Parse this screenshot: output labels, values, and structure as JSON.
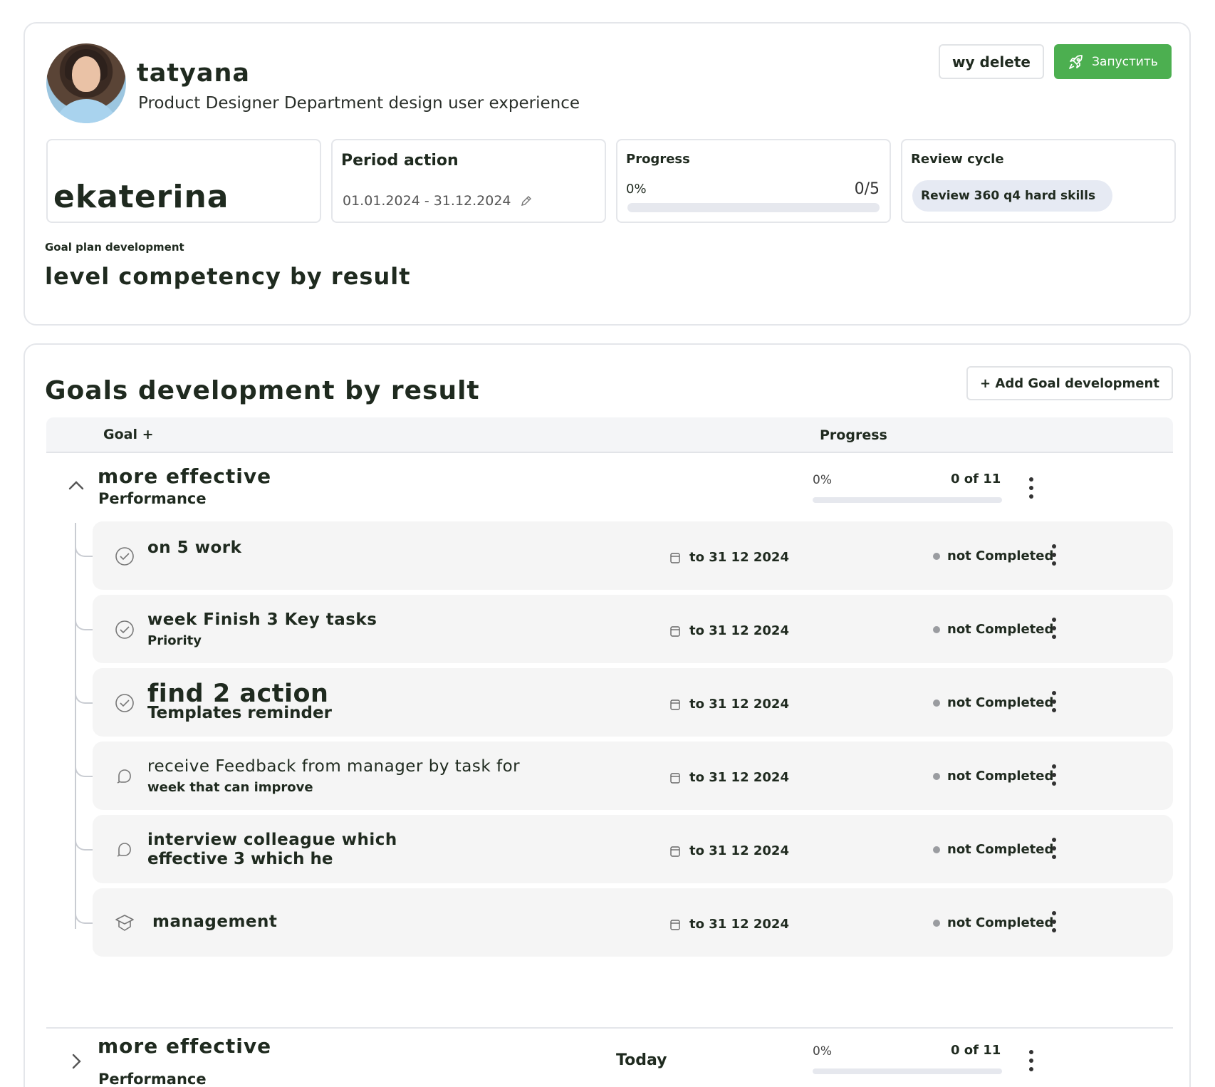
{
  "profile": {
    "name": "tatyana",
    "role": "Product Designer Department design user experience",
    "delete_label": "wy delete",
    "launch_label": "Запустить",
    "owner_name": "ekaterina",
    "period": {
      "title": "Period action",
      "dates": "01.01.2024 - 31.12.2024"
    },
    "progress": {
      "title": "Progress",
      "percent": "0%",
      "count": "0/5",
      "fraction": 0
    },
    "review": {
      "title": "Review cycle",
      "chip": "Review 360 q4 hard skills"
    },
    "plan_label": "Goal plan development",
    "plan_title": "level competency by result"
  },
  "goals": {
    "section_title": "Goals development by result",
    "add_label": "+ Add Goal development",
    "columns": {
      "goal": "Goal +",
      "progress": "Progress"
    },
    "groups": [
      {
        "title": "more effective",
        "subtitle": "Performance",
        "percent": "0%",
        "count": "0 of 11",
        "expanded": true
      },
      {
        "title": "more effective",
        "subtitle": "Performance",
        "today": "Today",
        "percent": "0%",
        "count": "0 of 11",
        "expanded": false
      }
    ],
    "items": [
      {
        "title": "on 5 work",
        "subtitle": "",
        "icon": "check-circle-icon",
        "date": "to 31 12 2024",
        "status": "not Completed"
      },
      {
        "title": "week Finish 3 Key tasks",
        "subtitle": "Priority",
        "icon": "check-circle-icon",
        "date": "to 31 12 2024",
        "status": "not Completed"
      },
      {
        "title": "find 2 action",
        "subtitle": "Templates reminder",
        "icon": "check-circle-icon",
        "date": "to 31 12 2024",
        "status": "not Completed"
      },
      {
        "title": "receive Feedback from manager by task for",
        "subtitle": "week that can improve",
        "icon": "feedback-icon",
        "date": "to 31 12 2024",
        "status": "not Completed"
      },
      {
        "title": "interview colleague which",
        "subtitle": "effective 3 which he",
        "icon": "feedback-icon",
        "date": "to 31 12 2024",
        "status": "not Completed"
      },
      {
        "title": "management",
        "subtitle": "",
        "icon": "graduation-cap-icon",
        "date": "to 31 12 2024",
        "status": "not Completed"
      }
    ]
  },
  "colors": {
    "accent": "#4caf50",
    "status_dot": "#9a9ca0",
    "item_bg": "#f5f5f5"
  }
}
